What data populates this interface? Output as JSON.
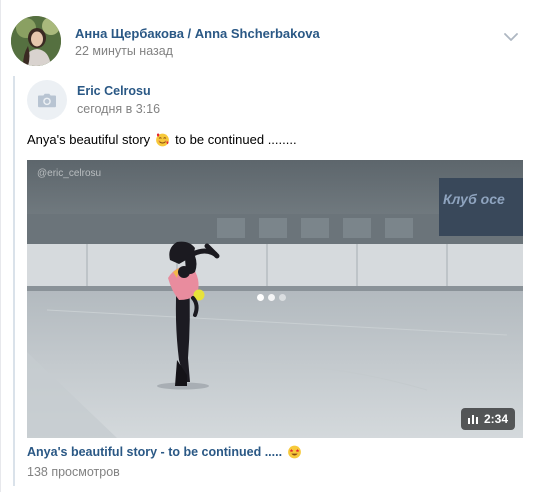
{
  "post": {
    "author_name": "Анна Щербакова / Anna Shcherbakova",
    "time": "22 минуты назад",
    "menu_icon": "chevron-down-icon"
  },
  "repost": {
    "author_name": "Eric Celrosu",
    "time": "сегодня в 3:16",
    "avatar_icon": "camera-icon",
    "text": "Anya's beautiful story",
    "text_suffix": "to be continued ........",
    "text_emoji": "smiling-face-with-hearts-icon"
  },
  "video": {
    "watermark": "@eric_celrosu",
    "rink_banner": "Клуб осе",
    "duration": "2:34",
    "title": "Anya's beautiful story - to be continued .....",
    "title_emoji": "star-struck-icon",
    "views": "138 просмотров"
  },
  "colors": {
    "link": "#2a5885",
    "meta": "#828282",
    "quote_border": "#dae2ea"
  }
}
